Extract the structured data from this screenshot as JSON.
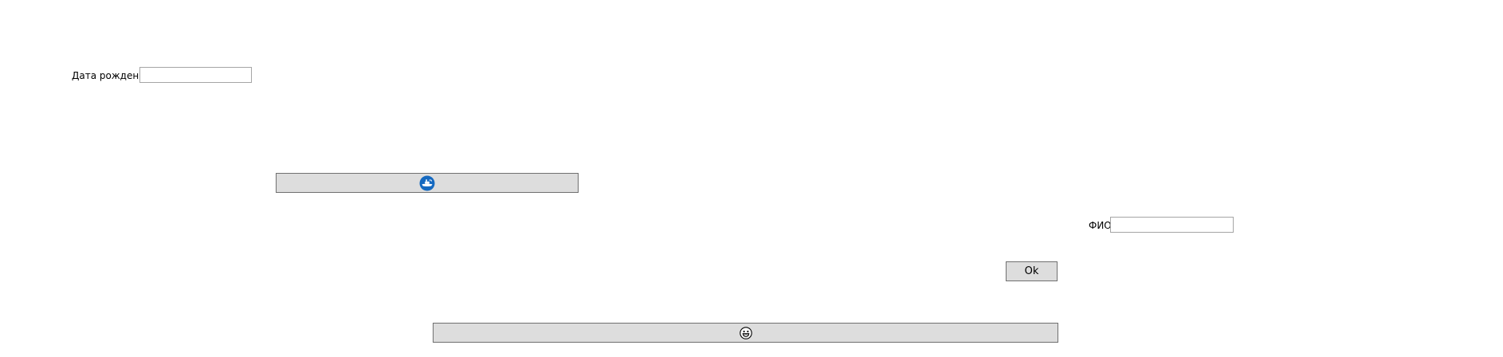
{
  "form": {
    "birth_date": {
      "label": "Дата рождения",
      "value": "",
      "placeholder": ""
    },
    "full_name": {
      "label": "ФИО",
      "value": "",
      "placeholder": ""
    },
    "ok_button": {
      "label": "Ok"
    },
    "icon_button_top": {
      "icon": "rocket-ship-icon",
      "accent_color": "#1569c0"
    },
    "icon_button_bottom": {
      "icon": "grinning-face-icon"
    }
  }
}
